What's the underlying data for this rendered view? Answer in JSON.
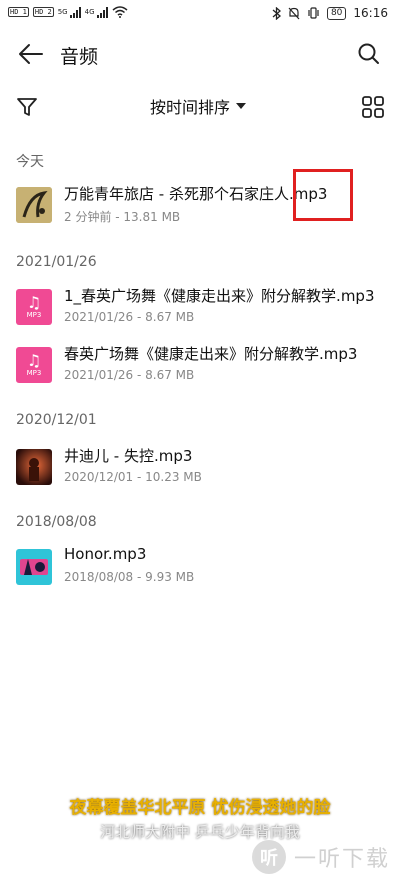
{
  "status_bar": {
    "sim1": "HD 1",
    "sim2": "HD 2",
    "net1": "5G",
    "net2": "4G",
    "battery": "80",
    "time": "16:16"
  },
  "header": {
    "title": "音频"
  },
  "toolbar": {
    "sort_label": "按时间排序"
  },
  "sections": [
    {
      "label": "今天",
      "files": [
        {
          "name": "万能青年旅店 - 杀死那个石家庄人.mp3",
          "meta": "2 分钟前 - 13.81 MB"
        }
      ]
    },
    {
      "label": "2021/01/26",
      "files": [
        {
          "name": "1_春英广场舞《健康走出来》附分解教学.mp3",
          "meta": "2021/01/26 - 8.67 MB",
          "icon_ext": "MP3"
        },
        {
          "name": "春英广场舞《健康走出来》附分解教学.mp3",
          "meta": "2021/01/26 - 8.67 MB",
          "icon_ext": "MP3"
        }
      ]
    },
    {
      "label": "2020/12/01",
      "files": [
        {
          "name": "井迪儿 - 失控.mp3",
          "meta": "2020/12/01 - 10.23 MB"
        }
      ]
    },
    {
      "label": "2018/08/08",
      "files": [
        {
          "name": "Honor.mp3",
          "meta": "2018/08/08 - 9.93 MB"
        }
      ]
    }
  ],
  "overlay": {
    "subtitle_line1": "夜幕覆盖华北平原 忧伤浸透她的脸",
    "subtitle_line2": "河北师大附中 乒乓少年背向我",
    "watermark_text": "一听下载",
    "watermark_logo": "听"
  },
  "colors": {
    "accent_pink": "#f04a94",
    "highlight_red": "#e02020",
    "subtitle_yellow": "#e8b000"
  }
}
